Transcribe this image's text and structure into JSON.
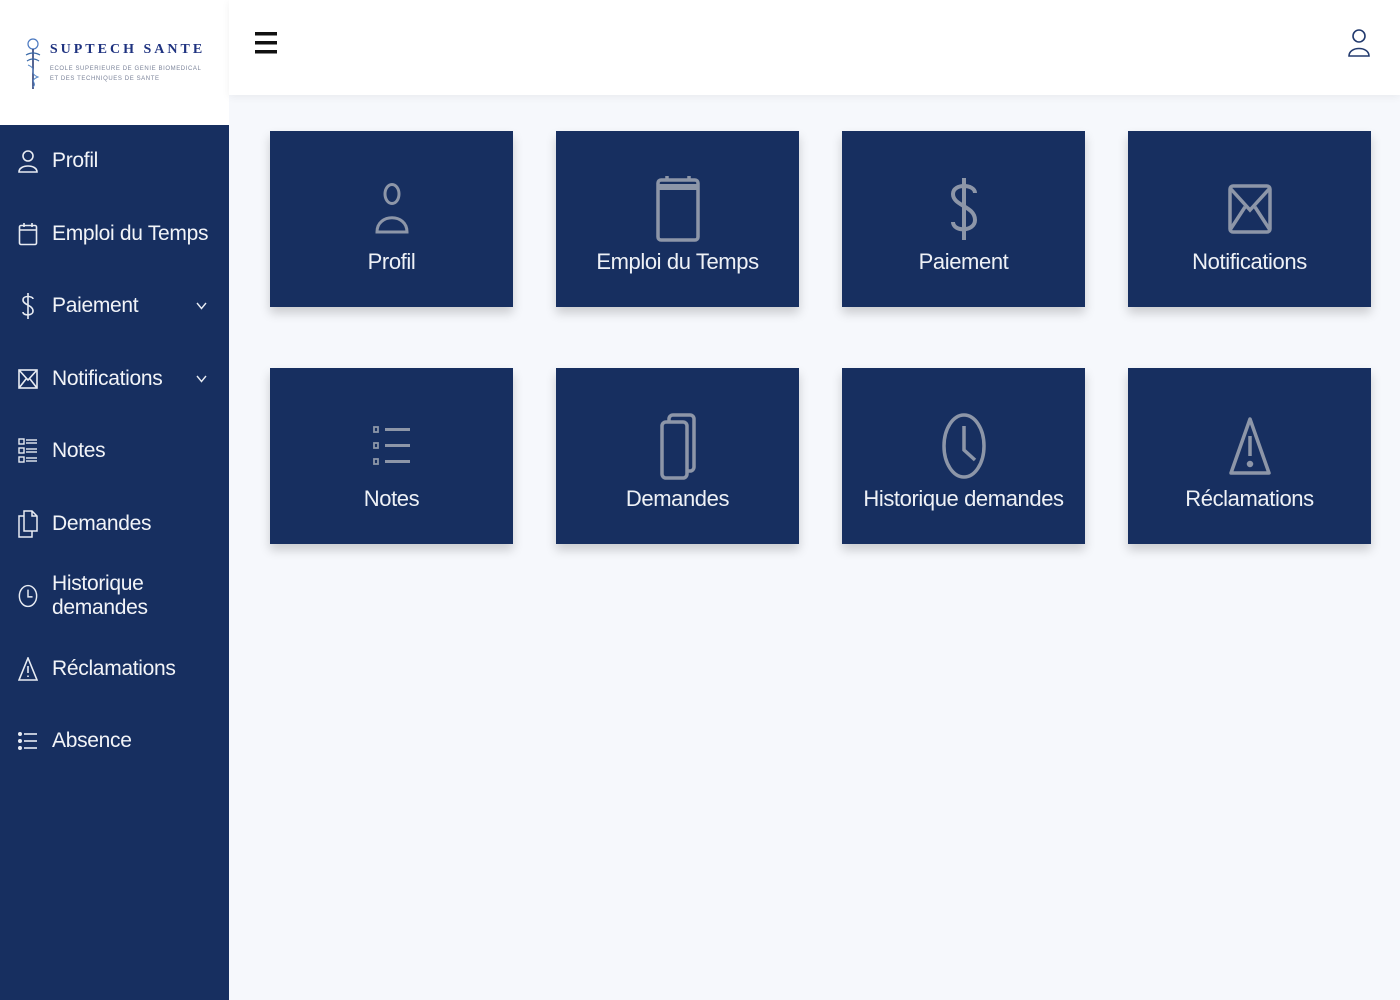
{
  "logo": {
    "name": "SUPTECH SANTE",
    "subtitle_line1": "ECOLE SUPERIEURE DE GENIE BIOMEDICAL",
    "subtitle_line2": "ET DES TECHNIQUES DE SANTE"
  },
  "colors": {
    "sidebar_bg": "#172f60",
    "card_bg": "#172f60",
    "card_icon": "#8d96a8",
    "content_bg": "#f6f8fc",
    "logo_text": "#1f3380"
  },
  "sidebar": {
    "items": [
      {
        "label": "Profil",
        "icon": "user-icon",
        "has_submenu": false
      },
      {
        "label": "Emploi du Temps",
        "icon": "calendar-icon",
        "has_submenu": false
      },
      {
        "label": "Paiement",
        "icon": "dollar-icon",
        "has_submenu": true
      },
      {
        "label": "Notifications",
        "icon": "envelope-icon",
        "has_submenu": true
      },
      {
        "label": "Notes",
        "icon": "list-details-icon",
        "has_submenu": false
      },
      {
        "label": "Demandes",
        "icon": "documents-icon",
        "has_submenu": false
      },
      {
        "label": "Historique demandes",
        "icon": "clock-icon",
        "has_submenu": false
      },
      {
        "label": "Réclamations",
        "icon": "warning-icon",
        "has_submenu": false
      },
      {
        "label": "Absence",
        "icon": "list-icon",
        "has_submenu": false
      }
    ]
  },
  "topbar": {
    "menu_icon": "hamburger-icon",
    "user_icon": "user-icon"
  },
  "cards": [
    {
      "label": "Profil",
      "icon": "user-icon"
    },
    {
      "label": "Emploi du Temps",
      "icon": "calendar-icon"
    },
    {
      "label": "Paiement",
      "icon": "dollar-icon"
    },
    {
      "label": "Notifications",
      "icon": "envelope-icon"
    },
    {
      "label": "Notes",
      "icon": "list-icon"
    },
    {
      "label": "Demandes",
      "icon": "documents-icon"
    },
    {
      "label": "Historique demandes",
      "icon": "clock-icon"
    },
    {
      "label": "Réclamations",
      "icon": "warning-icon"
    }
  ]
}
